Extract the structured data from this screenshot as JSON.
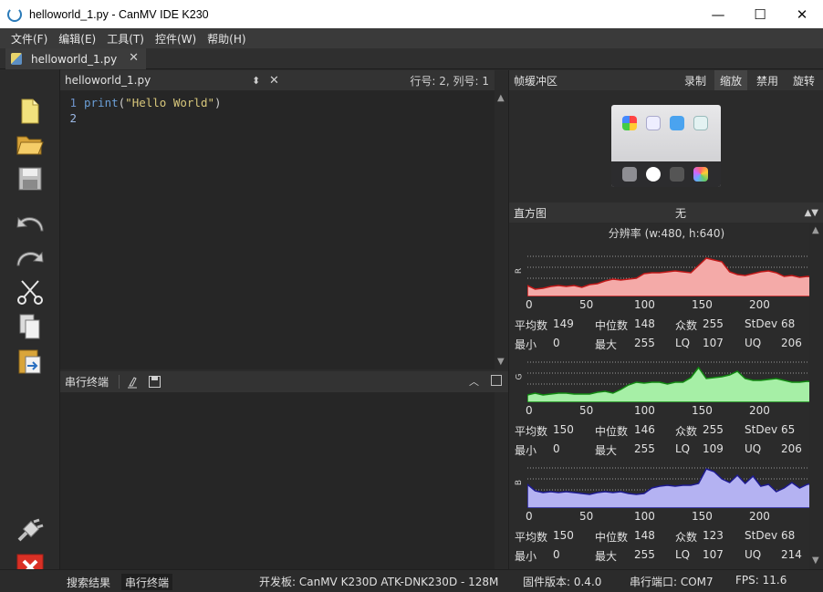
{
  "window": {
    "title": "helloworld_1.py - CanMV IDE K230",
    "minimize": "—",
    "maximize": "☐",
    "close": "✕"
  },
  "menu": [
    "文件(F)",
    "编辑(E)",
    "工具(T)",
    "控件(W)",
    "帮助(H)"
  ],
  "tab": {
    "label": "helloworld_1.py",
    "close": "✕"
  },
  "toolbar": [
    "new-file-icon",
    "open-folder-icon",
    "save-icon",
    "undo-icon",
    "redo-icon",
    "cut-icon",
    "copy-icon",
    "paste-icon"
  ],
  "editor": {
    "filename": "helloworld_1.py",
    "position": "行号: 2, 列号: 1",
    "lines": [
      {
        "num": "1",
        "kw": "print",
        "open": "(",
        "str": "\"Hello World\"",
        "close": ")"
      },
      {
        "num": "2"
      }
    ]
  },
  "terminal": {
    "title": "串行终端"
  },
  "framebuffer": {
    "title": "帧缓冲区",
    "buttons": [
      "录制",
      "缩放",
      "禁用",
      "旋转"
    ],
    "active": "缩放"
  },
  "histogram": {
    "title": "直方图",
    "mode": "无",
    "resolution": "分辨率 (w:480, h:640)",
    "ticks": [
      "0",
      "50",
      "100",
      "150",
      "200"
    ],
    "channels": [
      {
        "letter": "R",
        "color": "#f4aaa8",
        "stroke": "#c01818",
        "mean": "149",
        "median": "148",
        "mode": "255",
        "stdev": "68",
        "min": "0",
        "max": "255",
        "lq": "107",
        "uq": "206"
      },
      {
        "letter": "G",
        "color": "#a6efa6",
        "stroke": "#118811",
        "mean": "150",
        "median": "146",
        "mode": "255",
        "stdev": "65",
        "min": "0",
        "max": "255",
        "lq": "109",
        "uq": "206"
      },
      {
        "letter": "B",
        "color": "#b4b2f2",
        "stroke": "#1d1a90",
        "mean": "150",
        "median": "148",
        "mode": "123",
        "stdev": "68",
        "min": "0",
        "max": "255",
        "lq": "107",
        "uq": "214"
      }
    ],
    "labels": {
      "mean": "平均数",
      "median": "中位数",
      "mode": "众数",
      "stdev": "StDev",
      "min": "最小",
      "max": "最大",
      "lq": "LQ",
      "uq": "UQ"
    }
  },
  "status": {
    "tabs": [
      "搜索结果",
      "串行终端"
    ],
    "board": "开发板: CanMV K230D ATK-DNK230D - 128M",
    "firmware": "固件版本: 0.4.0",
    "port": "串行端口: COM7",
    "fps": "FPS: 11.6"
  }
}
